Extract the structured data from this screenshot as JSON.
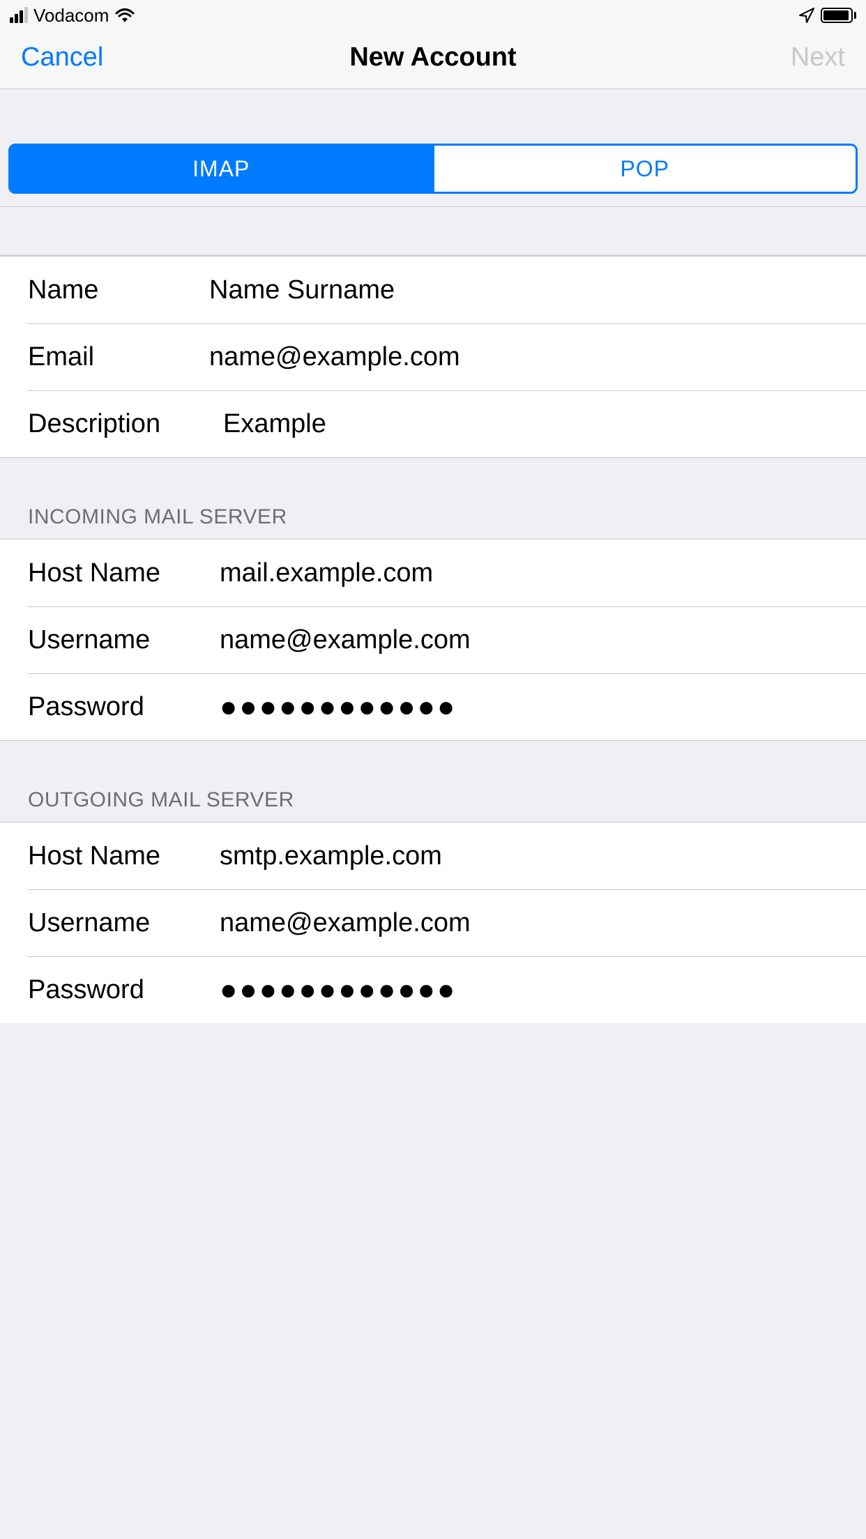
{
  "status": {
    "carrier": "Vodacom"
  },
  "nav": {
    "cancel": "Cancel",
    "title": "New Account",
    "next": "Next"
  },
  "segmented": {
    "imap": "IMAP",
    "pop": "POP"
  },
  "account": {
    "name_label": "Name",
    "name_value": "Name Surname",
    "email_label": "Email",
    "email_value": "name@example.com",
    "description_label": "Description",
    "description_value": "Example"
  },
  "incoming": {
    "header": "Incoming Mail Server",
    "host_label": "Host Name",
    "host_value": "mail.example.com",
    "user_label": "Username",
    "user_value": "name@example.com",
    "pass_label": "Password",
    "pass_value": "●●●●●●●●●●●●"
  },
  "outgoing": {
    "header": "Outgoing Mail Server",
    "host_label": "Host Name",
    "host_value": "smtp.example.com",
    "user_label": "Username",
    "user_value": "name@example.com",
    "pass_label": "Password",
    "pass_value": "●●●●●●●●●●●●"
  }
}
